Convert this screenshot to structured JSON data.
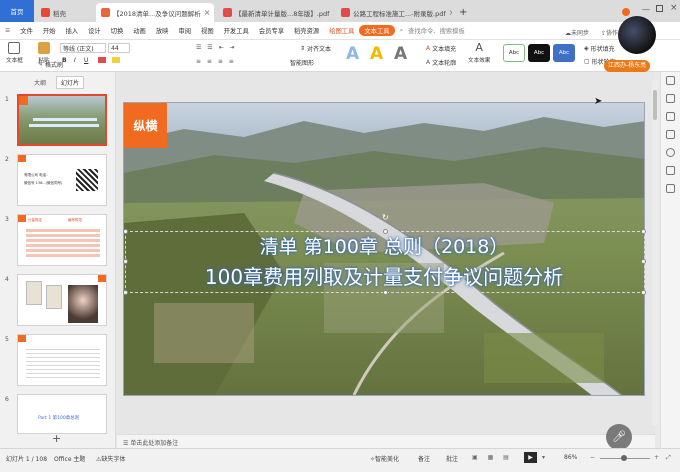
{
  "tabs": [
    {
      "label": "首页",
      "active": false
    },
    {
      "label": "稻壳",
      "active": false
    },
    {
      "label": "【2018清单...及争议问题解析",
      "active": true
    },
    {
      "label": "【最新清单计量版...8年版】.pdf",
      "active": false
    },
    {
      "label": "公路工程标准施工...-附录版.pdf",
      "active": false
    }
  ],
  "new_tab": "+",
  "ribbon_tabs": [
    "文件",
    "开始",
    "插入",
    "设计",
    "切换",
    "动画",
    "放映",
    "审阅",
    "视图",
    "开发工具",
    "会员专享",
    "稻壳资源",
    "绘图工具",
    "文本工具"
  ],
  "ribbon_search": "查找命令、搜索模板",
  "cloud": "未同步",
  "share": "协作",
  "ribbon": {
    "new_slide": "文本框",
    "paste": "粘贴",
    "format_painter": "格式刷",
    "font": "等线 (正文)",
    "font_size": "44",
    "bold": "B",
    "italic": "I",
    "underline": "U",
    "align": "对齐文本",
    "text_fill": "文本填充",
    "text_outline": "文本轮廓",
    "text_effect": "文本效果",
    "style_a": "Abc",
    "shape_fill": "形状填充",
    "shape_outline": "形状轮廓",
    "smart": "智能图形"
  },
  "user_badge": "江西办-杨东亮",
  "pane_tabs": [
    "大纲",
    "幻灯片"
  ],
  "thumbnails": [
    {
      "num": "1",
      "tag": "纵横"
    },
    {
      "num": "2",
      "tag": "纵横",
      "text": "有限公司 电话：",
      "text2": "微信号 138...(微信同号)"
    },
    {
      "num": "3",
      "tag": "纵横",
      "text": "计量规定",
      "text2": "编号规范"
    },
    {
      "num": "4",
      "tag": "纵横"
    },
    {
      "num": "5",
      "tag": "纵横"
    },
    {
      "num": "6",
      "tag": "",
      "text": "Part 1 第100章总则"
    }
  ],
  "add_slide": "+",
  "slide": {
    "logo": "纵横",
    "title_line1": "清单 第100章 总则（2018）",
    "title_line2": "100章费用列取及计量支付争议问题分析"
  },
  "notes": "单击此处添加备注",
  "status": {
    "slide_info": "幻灯片 1 / 108",
    "theme": "Office 主题",
    "missing_font": "缺失字体",
    "smart": "智能美化",
    "notes": "备注",
    "comments": "批注",
    "zoom": "86%"
  },
  "colors": {
    "brand_orange": "#f06b1f",
    "title_text": "#ffffff",
    "selection_border": "#e04a2a"
  }
}
